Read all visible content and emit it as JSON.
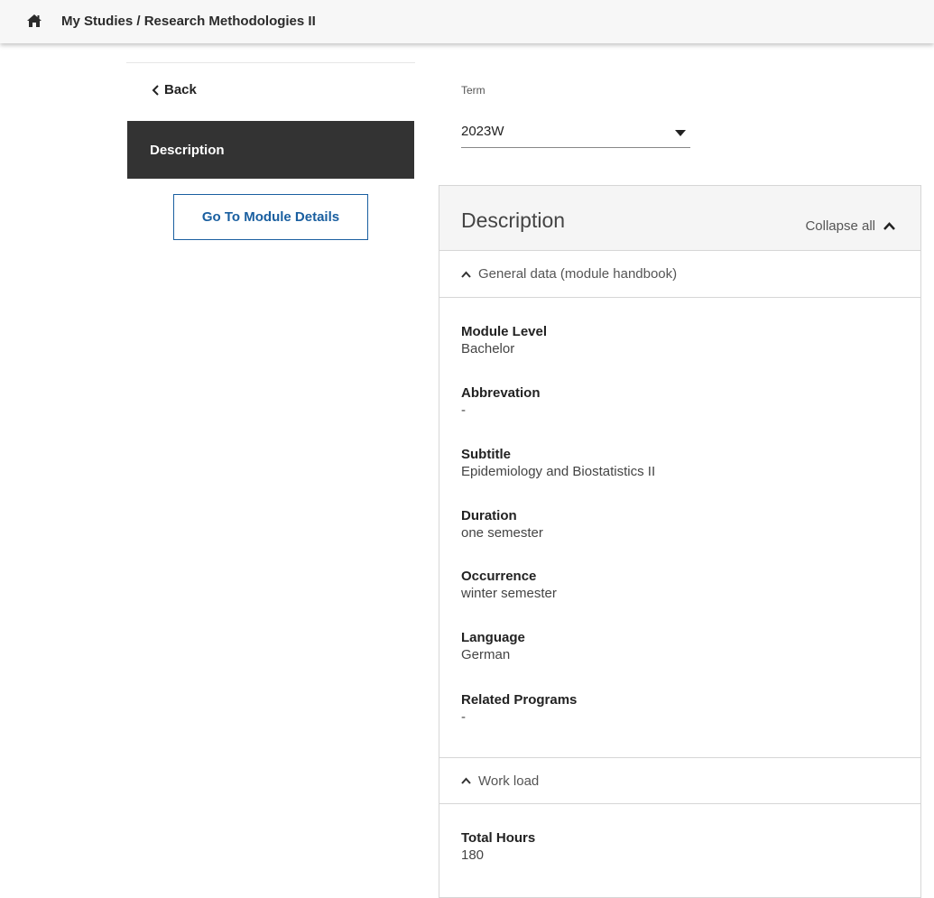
{
  "header": {
    "breadcrumb": {
      "root": "My Studies",
      "separator": " / ",
      "current": "Research Methodologies II"
    },
    "home_icon": "home-icon"
  },
  "sidebar": {
    "back_label": "Back",
    "active_item": "Description",
    "module_button": "Go To Module Details"
  },
  "term": {
    "label": "Term",
    "value": "2023W"
  },
  "panel": {
    "title": "Description",
    "collapse_all": "Collapse all",
    "general_section": {
      "title": "General data (module handbook)",
      "fields": [
        {
          "label": "Module Level",
          "value": "Bachelor"
        },
        {
          "label": "Abbrevation",
          "value": "-"
        },
        {
          "label": "Subtitle",
          "value": "Epidemiology and Biostatistics II"
        },
        {
          "label": "Duration",
          "value": "one semester"
        },
        {
          "label": "Occurrence",
          "value": "winter semester"
        },
        {
          "label": "Language",
          "value": "German"
        },
        {
          "label": "Related Programs",
          "value": "-"
        }
      ]
    },
    "workload_section": {
      "title": "Work load",
      "fields": [
        {
          "label": "Total Hours",
          "value": "180"
        }
      ]
    }
  },
  "colors": {
    "accent": "#1a5fa0",
    "nav_active_bg": "#333333"
  }
}
